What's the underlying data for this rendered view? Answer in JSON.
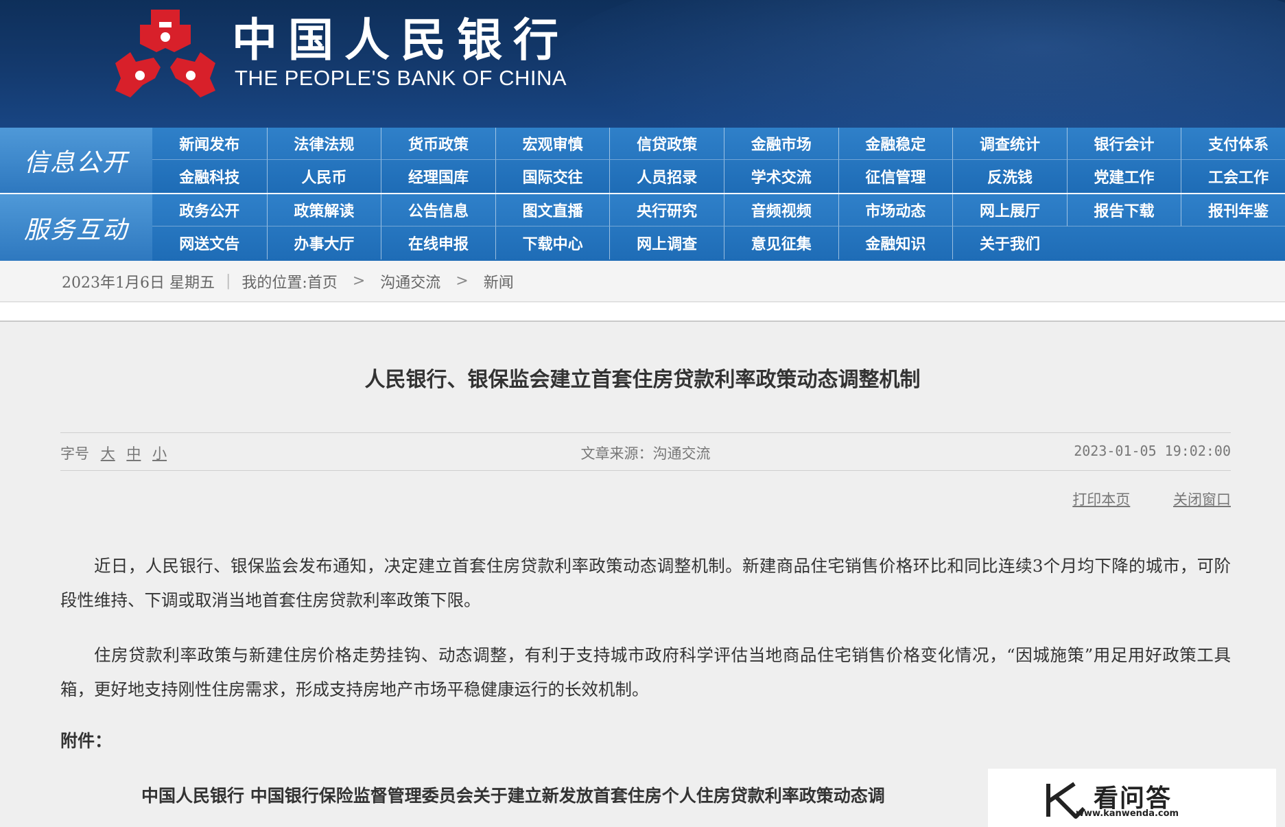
{
  "colors": {
    "header_bg": "#143a6e",
    "nav_bg": "#1e6cb6",
    "emblem_red": "#d8202a"
  },
  "header": {
    "logo_cn": "中国人民银行",
    "logo_en": "THE PEOPLE'S BANK OF CHINA"
  },
  "nav": {
    "group1": {
      "label": "信息公开",
      "items": [
        "新闻发布",
        "法律法规",
        "货币政策",
        "宏观审慎",
        "信贷政策",
        "金融市场",
        "金融稳定",
        "调查统计",
        "银行会计",
        "支付体系",
        "金融科技",
        "人民币",
        "经理国库",
        "国际交往",
        "人员招录",
        "学术交流",
        "征信管理",
        "反洗钱",
        "党建工作",
        "工会工作"
      ]
    },
    "group2": {
      "label": "服务互动",
      "items": [
        "政务公开",
        "政策解读",
        "公告信息",
        "图文直播",
        "央行研究",
        "音频视频",
        "市场动态",
        "网上展厅",
        "报告下载",
        "报刊年鉴",
        "网送文告",
        "办事大厅",
        "在线申报",
        "下载中心",
        "网上调查",
        "意见征集",
        "金融知识",
        "关于我们"
      ]
    }
  },
  "breadcrumb": {
    "date": "2023年1月6日  星期五",
    "sep": "|",
    "location_prefix": "我的位置:",
    "home": "首页",
    "arrow": ">",
    "section": "沟通交流",
    "current": "新闻"
  },
  "article": {
    "title": "人民银行、银保监会建立首套住房贷款利率政策动态调整机制",
    "font_size_label": "字号",
    "font_sizes": [
      "大",
      "中",
      "小"
    ],
    "source": "文章来源：沟通交流",
    "time": "2023-01-05 19:02:00",
    "print_label": "打印本页",
    "close_label": "关闭窗口",
    "paragraphs": [
      "近日，人民银行、银保监会发布通知，决定建立首套住房贷款利率政策动态调整机制。新建商品住宅销售价格环比和同比连续3个月均下降的城市，可阶段性维持、下调或取消当地首套住房贷款利率政策下限。",
      "住房贷款利率政策与新建住房价格走势挂钩、动态调整，有利于支持城市政府科学评估当地商品住宅销售价格变化情况，“因城施策”用足用好政策工具箱，更好地支持刚性住房需求，形成支持房地产市场平稳健康运行的长效机制。"
    ],
    "attachment_label": "附件：",
    "attachment_title": "中国人民银行  中国银行保险监督管理委员会关于建立新发放首套住房个人住房贷款利率政策动态调"
  },
  "watermark": {
    "name": "看问答",
    "url": "www.kanwenda.com"
  }
}
